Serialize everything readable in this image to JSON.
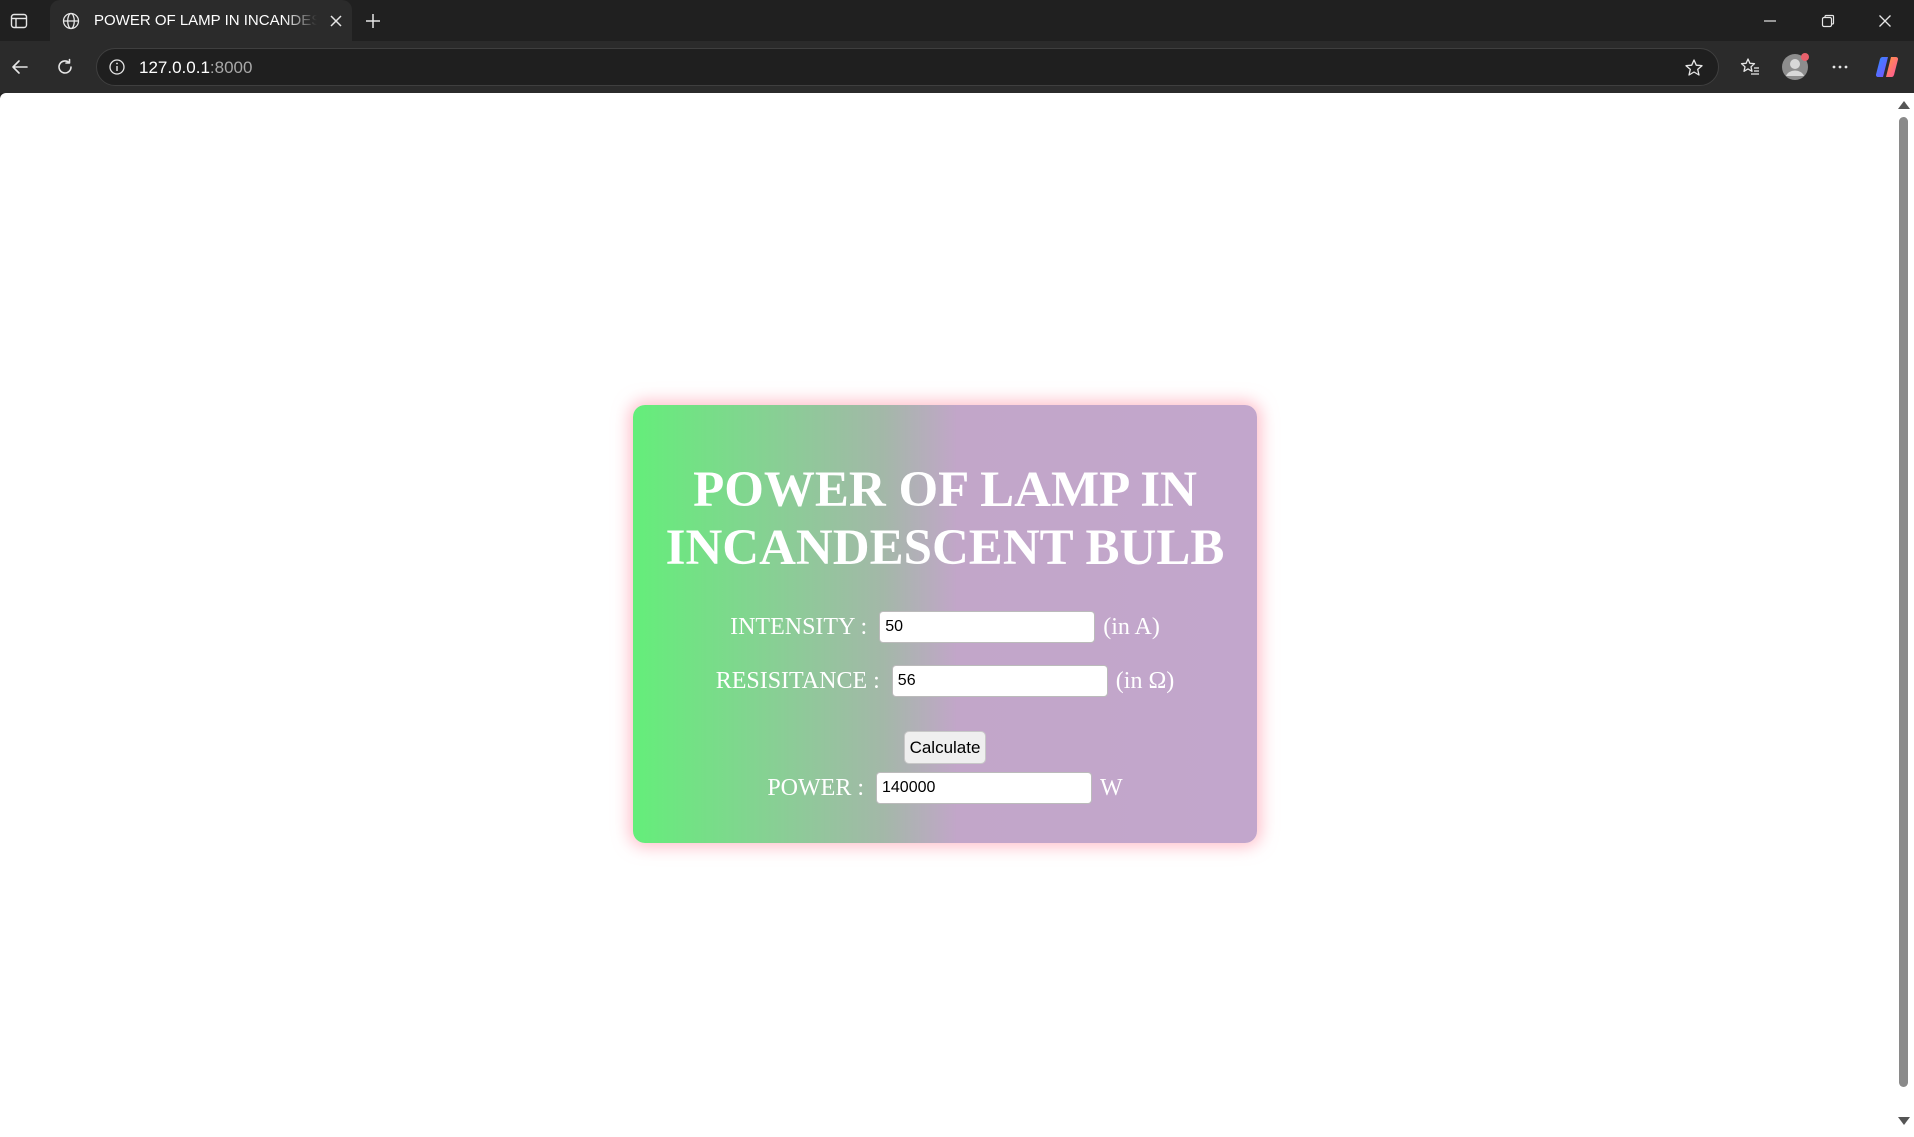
{
  "browser": {
    "tab_title": "POWER OF LAMP IN INCANDESCENT BULB",
    "url_host": "127.0.0.1",
    "url_port": ":8000"
  },
  "icons": {
    "tab_panel": "tab-panel-icon",
    "tab_favicon": "globe-icon",
    "tab_close": "close-icon",
    "new_tab": "plus-icon",
    "back": "back-arrow-icon",
    "reload": "reload-icon",
    "site_info": "info-icon",
    "favorite": "star-icon",
    "favorites": "favorites-icon",
    "profile": "profile-icon",
    "menu": "more-icon",
    "copilot": "copilot-icon"
  },
  "colors": {
    "gradient_start": "#64ee7a",
    "gradient_end": "#c2a6cc",
    "card_glow": "#ff8ca0"
  },
  "page": {
    "title": "POWER OF LAMP IN INCANDESCENT BULB",
    "intensity": {
      "label": "INTENSITY :",
      "value": "50",
      "unit": "(in A)"
    },
    "resistance": {
      "label": "RESISITANCE :",
      "value": "56",
      "unit": "(in Ω)"
    },
    "calculate_label": "Calculate",
    "power": {
      "label": "POWER :",
      "value": "140000",
      "unit": "W"
    }
  }
}
